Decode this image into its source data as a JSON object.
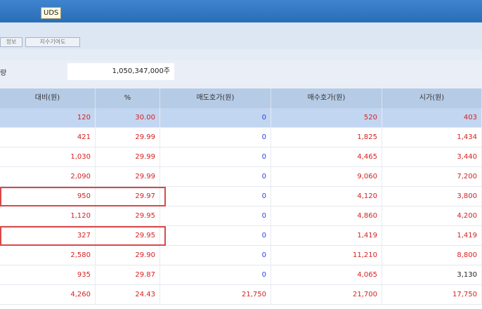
{
  "window": {
    "title": "UDS"
  },
  "tabs": [
    {
      "label": "정보"
    },
    {
      "label": "지수기여도"
    }
  ],
  "filter": {
    "label": "량",
    "amount_value": "1,050,347,000주"
  },
  "table": {
    "columns": [
      "대비(원)",
      "%",
      "매도호가(원)",
      "매수호가(원)",
      "시가(원)"
    ],
    "rows": [
      {
        "diff": "120",
        "pct": "30.00",
        "ask": "0",
        "bid": "520",
        "open": "403",
        "open_color": "red"
      },
      {
        "diff": "421",
        "pct": "29.99",
        "ask": "0",
        "bid": "1,825",
        "open": "1,434",
        "open_color": "red"
      },
      {
        "diff": "1,030",
        "pct": "29.99",
        "ask": "0",
        "bid": "4,465",
        "open": "3,440",
        "open_color": "red"
      },
      {
        "diff": "2,090",
        "pct": "29.99",
        "ask": "0",
        "bid": "9,060",
        "open": "7,200",
        "open_color": "red"
      },
      {
        "diff": "950",
        "pct": "29.97",
        "ask": "0",
        "bid": "4,120",
        "open": "3,800",
        "open_color": "red"
      },
      {
        "diff": "1,120",
        "pct": "29.95",
        "ask": "0",
        "bid": "4,860",
        "open": "4,200",
        "open_color": "red"
      },
      {
        "diff": "327",
        "pct": "29.95",
        "ask": "0",
        "bid": "1,419",
        "open": "1,419",
        "open_color": "red"
      },
      {
        "diff": "2,580",
        "pct": "29.90",
        "ask": "0",
        "bid": "11,210",
        "open": "8,800",
        "open_color": "red"
      },
      {
        "diff": "935",
        "pct": "29.87",
        "ask": "0",
        "bid": "4,065",
        "open": "3,130",
        "open_color": "dark"
      },
      {
        "diff": "4,260",
        "pct": "24.43",
        "ask": "21,750",
        "bid": "21,700",
        "open": "17,750",
        "open_color": "red"
      }
    ],
    "selected_row_index": 0,
    "highlighted_row_indexes": [
      4,
      6
    ]
  },
  "colors": {
    "titlebar": "#2f75c2",
    "header": "#b6cbe6",
    "selected_row": "#c3d6f1",
    "up_red": "#d62020",
    "zero_blue": "#2a3fe0",
    "highlight_border": "#d94848"
  }
}
